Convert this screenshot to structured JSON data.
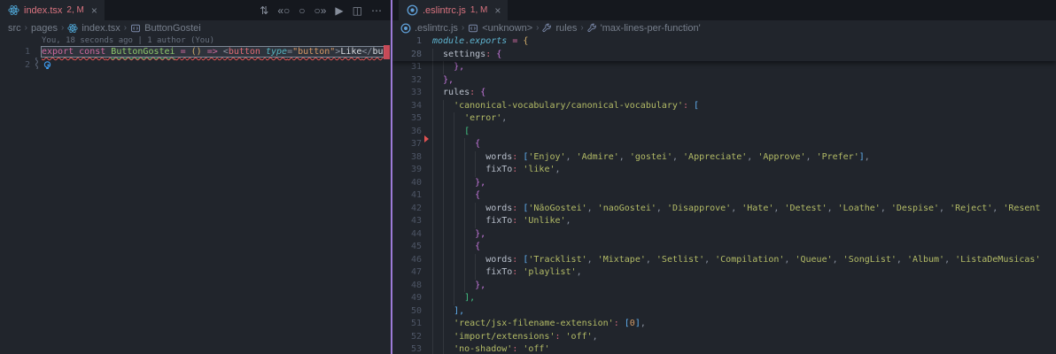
{
  "left": {
    "tab": {
      "icon": "react-icon",
      "label": "index.tsx",
      "badge": "2, M",
      "close": "×"
    },
    "toolbar": [
      {
        "name": "compare-changes-icon",
        "glyph": "⇅"
      },
      {
        "name": "previous-change-icon",
        "glyph": "«○"
      },
      {
        "name": "current-change-icon",
        "glyph": "○"
      },
      {
        "name": "next-change-icon",
        "glyph": "○»"
      },
      {
        "name": "run-or-debug-icon",
        "glyph": "▶"
      },
      {
        "name": "split-editor-icon",
        "glyph": "◫"
      },
      {
        "name": "more-actions-icon",
        "glyph": "⋯"
      }
    ],
    "breadcrumb": [
      {
        "label": "src"
      },
      {
        "label": "pages"
      },
      {
        "icon": "react-icon",
        "label": "index.tsx"
      },
      {
        "icon": "symbol-box-icon",
        "label": "ButtonGostei"
      }
    ],
    "codelens": "You, 18 seconds ago | 1 author (You)",
    "lines": [
      {
        "num": "1",
        "hl": true,
        "gutterDecoration": "modified-squiggle",
        "seg": [
          [
            "kw",
            "export"
          ],
          [
            "txt",
            " "
          ],
          [
            "kw",
            "const"
          ],
          [
            "txt",
            " "
          ],
          [
            "fn",
            "ButtonGostei"
          ],
          [
            "txt",
            " "
          ],
          [
            "op",
            "="
          ],
          [
            "txt",
            " "
          ],
          [
            "b1",
            "()"
          ],
          [
            "txt",
            " "
          ],
          [
            "op",
            "=>"
          ],
          [
            "txt",
            " "
          ],
          [
            "pun",
            "<"
          ],
          [
            "tag",
            "button"
          ],
          [
            "txt",
            " "
          ],
          [
            "attr",
            "type"
          ],
          [
            "pun",
            "="
          ],
          [
            "jstr",
            "\"button\""
          ],
          [
            "pun",
            ">"
          ],
          [
            "txt",
            "Like"
          ],
          [
            "pun",
            "</"
          ],
          [
            "txt",
            "bu"
          ]
        ]
      },
      {
        "num": "2",
        "lightbulb": "code-action-lightbulb-icon",
        "seg": []
      }
    ]
  },
  "right": {
    "tab": {
      "icon": "eslint-icon",
      "label": ".eslintrc.js",
      "badge": "1, M",
      "close": "×"
    },
    "breadcrumb": [
      {
        "icon": "eslint-icon",
        "label": ".eslintrc.js"
      },
      {
        "icon": "symbol-box-icon",
        "label": "<unknown>"
      },
      {
        "icon": "wrench-icon",
        "label": "rules"
      },
      {
        "icon": "wrench-icon",
        "label": "'max-lines-per-function'"
      }
    ],
    "sticky": [
      {
        "num": "1",
        "ind": 0,
        "seg": [
          [
            "it",
            "module"
          ],
          [
            "pun",
            "."
          ],
          [
            "it",
            "exports"
          ],
          [
            "txt",
            " "
          ],
          [
            "op",
            "="
          ],
          [
            "txt",
            " "
          ],
          [
            "b1",
            "{"
          ]
        ]
      },
      {
        "num": "28",
        "ind": 2,
        "seg": [
          [
            "prop",
            "settings"
          ],
          [
            "col",
            ":"
          ],
          [
            "txt",
            " "
          ],
          [
            "b2",
            "{"
          ]
        ]
      }
    ],
    "lines": [
      {
        "num": "31",
        "ind": 4,
        "seg": [
          [
            "b2",
            "},"
          ]
        ]
      },
      {
        "num": "32",
        "ind": 2,
        "seg": [
          [
            "b2",
            "},"
          ]
        ]
      },
      {
        "num": "33",
        "ind": 2,
        "seg": [
          [
            "prop",
            "rules"
          ],
          [
            "col",
            ":"
          ],
          [
            "txt",
            " "
          ],
          [
            "b2",
            "{"
          ]
        ]
      },
      {
        "num": "34",
        "ind": 4,
        "seg": [
          [
            "str",
            "'canonical-vocabulary/canonical-vocabulary'"
          ],
          [
            "col",
            ":"
          ],
          [
            "txt",
            " "
          ],
          [
            "b3",
            "["
          ]
        ]
      },
      {
        "num": "35",
        "ind": 6,
        "seg": [
          [
            "str",
            "'error'"
          ],
          [
            "pun",
            ","
          ]
        ]
      },
      {
        "num": "36",
        "ind": 6,
        "seg": [
          [
            "b4",
            "["
          ]
        ]
      },
      {
        "num": "37",
        "ind": 8,
        "seg": [
          [
            "b2",
            "{"
          ]
        ]
      },
      {
        "num": "38",
        "ind": 10,
        "seg": [
          [
            "prop",
            "words"
          ],
          [
            "col",
            ":"
          ],
          [
            "txt",
            " "
          ],
          [
            "b3",
            "["
          ],
          [
            "str",
            "'Enjoy'"
          ],
          [
            "pun",
            ", "
          ],
          [
            "str",
            "'Admire'"
          ],
          [
            "pun",
            ", "
          ],
          [
            "str",
            "'gostei'"
          ],
          [
            "pun",
            ", "
          ],
          [
            "str",
            "'Appreciate'"
          ],
          [
            "pun",
            ", "
          ],
          [
            "str",
            "'Approve'"
          ],
          [
            "pun",
            ", "
          ],
          [
            "str",
            "'Prefer'"
          ],
          [
            "b3",
            "]"
          ],
          [
            "pun",
            ","
          ]
        ]
      },
      {
        "num": "39",
        "ind": 10,
        "seg": [
          [
            "prop",
            "fixTo"
          ],
          [
            "col",
            ":"
          ],
          [
            "txt",
            " "
          ],
          [
            "str",
            "'like'"
          ],
          [
            "pun",
            ","
          ]
        ]
      },
      {
        "num": "40",
        "ind": 8,
        "seg": [
          [
            "b2",
            "},"
          ]
        ]
      },
      {
        "num": "41",
        "ind": 8,
        "seg": [
          [
            "b2",
            "{"
          ]
        ]
      },
      {
        "num": "42",
        "ind": 10,
        "seg": [
          [
            "prop",
            "words"
          ],
          [
            "col",
            ":"
          ],
          [
            "txt",
            " "
          ],
          [
            "b3",
            "["
          ],
          [
            "str",
            "'NãoGostei'"
          ],
          [
            "pun",
            ", "
          ],
          [
            "str",
            "'naoGostei'"
          ],
          [
            "pun",
            ", "
          ],
          [
            "str",
            "'Disapprove'"
          ],
          [
            "pun",
            ", "
          ],
          [
            "str",
            "'Hate'"
          ],
          [
            "pun",
            ", "
          ],
          [
            "str",
            "'Detest'"
          ],
          [
            "pun",
            ", "
          ],
          [
            "str",
            "'Loathe'"
          ],
          [
            "pun",
            ", "
          ],
          [
            "str",
            "'Despise'"
          ],
          [
            "pun",
            ", "
          ],
          [
            "str",
            "'Reject'"
          ],
          [
            "pun",
            ", "
          ],
          [
            "str",
            "'Resent"
          ]
        ]
      },
      {
        "num": "43",
        "ind": 10,
        "seg": [
          [
            "prop",
            "fixTo"
          ],
          [
            "col",
            ":"
          ],
          [
            "txt",
            " "
          ],
          [
            "str",
            "'Unlike'"
          ],
          [
            "pun",
            ","
          ]
        ]
      },
      {
        "num": "44",
        "ind": 8,
        "seg": [
          [
            "b2",
            "},"
          ]
        ]
      },
      {
        "num": "45",
        "ind": 8,
        "seg": [
          [
            "b2",
            "{"
          ]
        ]
      },
      {
        "num": "46",
        "ind": 10,
        "seg": [
          [
            "prop",
            "words"
          ],
          [
            "col",
            ":"
          ],
          [
            "txt",
            " "
          ],
          [
            "b3",
            "["
          ],
          [
            "str",
            "'Tracklist'"
          ],
          [
            "pun",
            ", "
          ],
          [
            "str",
            "'Mixtape'"
          ],
          [
            "pun",
            ", "
          ],
          [
            "str",
            "'Setlist'"
          ],
          [
            "pun",
            ", "
          ],
          [
            "str",
            "'Compilation'"
          ],
          [
            "pun",
            ", "
          ],
          [
            "str",
            "'Queue'"
          ],
          [
            "pun",
            ", "
          ],
          [
            "str",
            "'SongList'"
          ],
          [
            "pun",
            ", "
          ],
          [
            "str",
            "'Album'"
          ],
          [
            "pun",
            ", "
          ],
          [
            "str",
            "'ListaDeMusicas'"
          ]
        ]
      },
      {
        "num": "47",
        "ind": 10,
        "seg": [
          [
            "prop",
            "fixTo"
          ],
          [
            "col",
            ":"
          ],
          [
            "txt",
            " "
          ],
          [
            "str",
            "'playlist'"
          ],
          [
            "pun",
            ","
          ]
        ]
      },
      {
        "num": "48",
        "ind": 8,
        "seg": [
          [
            "b2",
            "},"
          ]
        ]
      },
      {
        "num": "49",
        "ind": 6,
        "seg": [
          [
            "b4",
            "],"
          ]
        ]
      },
      {
        "num": "50",
        "ind": 4,
        "seg": [
          [
            "b3",
            "],"
          ]
        ]
      },
      {
        "num": "51",
        "ind": 4,
        "seg": [
          [
            "str",
            "'react/jsx-filename-extension'"
          ],
          [
            "col",
            ":"
          ],
          [
            "txt",
            " "
          ],
          [
            "b3",
            "["
          ],
          [
            "num",
            "0"
          ],
          [
            "b3",
            "]"
          ],
          [
            "pun",
            ","
          ]
        ]
      },
      {
        "num": "52",
        "ind": 4,
        "seg": [
          [
            "str",
            "'import/extensions'"
          ],
          [
            "col",
            ":"
          ],
          [
            "txt",
            " "
          ],
          [
            "str",
            "'off'"
          ],
          [
            "pun",
            ","
          ]
        ]
      },
      {
        "num": "53",
        "ind": 4,
        "seg": [
          [
            "str",
            "'no-shadow'"
          ],
          [
            "col",
            ":"
          ],
          [
            "txt",
            " "
          ],
          [
            "str",
            "'off'"
          ]
        ]
      }
    ],
    "gutter_marker": {
      "name": "error-arrow-marker",
      "line": "37"
    }
  }
}
